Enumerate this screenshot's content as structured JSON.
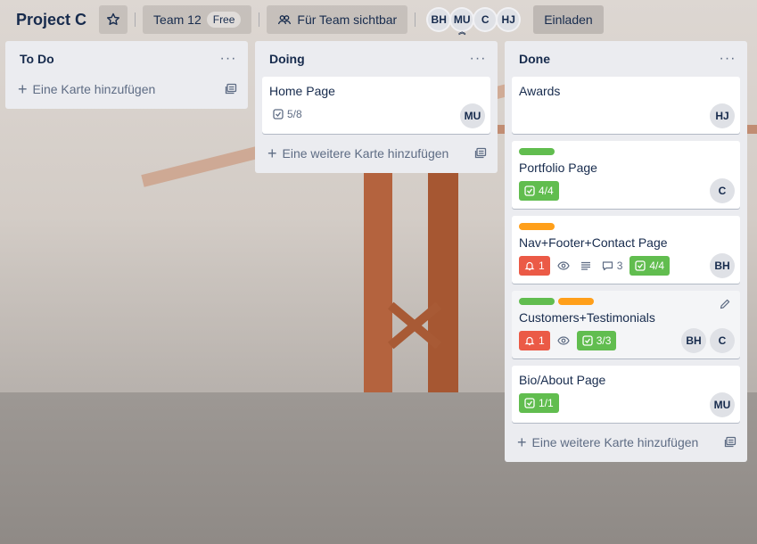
{
  "header": {
    "board_title": "Project C",
    "workspace": "Team 12",
    "workspace_badge": "Free",
    "visibility": "Für Team sichtbar",
    "members": [
      "BH",
      "MU",
      "C",
      "HJ"
    ],
    "invite": "Einladen"
  },
  "lists": {
    "todo": {
      "title": "To Do",
      "add_card": "Eine Karte hinzufügen"
    },
    "doing": {
      "title": "Doing",
      "add_card": "Eine weitere Karte hinzufügen",
      "cards": {
        "home": {
          "title": "Home Page",
          "checklist": "5/8",
          "member": "MU"
        }
      }
    },
    "done": {
      "title": "Done",
      "add_card": "Eine weitere Karte hinzufügen",
      "cards": {
        "awards": {
          "title": "Awards",
          "member": "HJ"
        },
        "portfolio": {
          "title": "Portfolio Page",
          "checklist": "4/4",
          "member": "C"
        },
        "navfooter": {
          "title": "Nav+Footer+Contact Page",
          "notifications": "1",
          "comments": "3",
          "checklist": "4/4",
          "member": "BH"
        },
        "customers": {
          "title": "Customers+Testimonials",
          "notifications": "1",
          "checklist": "3/3",
          "members": [
            "BH",
            "C"
          ]
        },
        "bio": {
          "title": "Bio/About Page",
          "checklist": "1/1",
          "member": "MU"
        }
      }
    }
  },
  "colors": {
    "green_label": "#61bd4f",
    "orange_label": "#ff9f1a",
    "red_badge": "#eb5a46",
    "list_bg": "#ebecf0"
  }
}
